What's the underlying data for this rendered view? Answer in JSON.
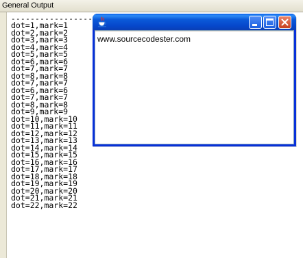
{
  "panel": {
    "title": "General Output",
    "separator": "--------------------"
  },
  "output_lines": [
    "dot=1,mark=1",
    "dot=2,mark=2",
    "dot=3,mark=3",
    "dot=4,mark=4",
    "dot=5,mark=5",
    "dot=6,mark=6",
    "dot=7,mark=7",
    "dot=8,mark=8",
    "dot=7,mark=7",
    "dot=6,mark=6",
    "dot=7,mark=7",
    "dot=8,mark=8",
    "dot=9,mark=9",
    "dot=10,mark=10",
    "dot=11,mark=11",
    "dot=12,mark=12",
    "dot=13,mark=13",
    "dot=14,mark=14",
    "dot=15,mark=15",
    "dot=16,mark=16",
    "dot=17,mark=17",
    "dot=18,mark=18",
    "dot=19,mark=19",
    "dot=20,mark=20",
    "dot=21,mark=21",
    "dot=22,mark=22"
  ],
  "window": {
    "title": "",
    "content_text": "www.sourcecodester.com",
    "icon": "java-icon",
    "colors": {
      "titlebar": "#0b5ad9",
      "close": "#c6401e"
    }
  }
}
